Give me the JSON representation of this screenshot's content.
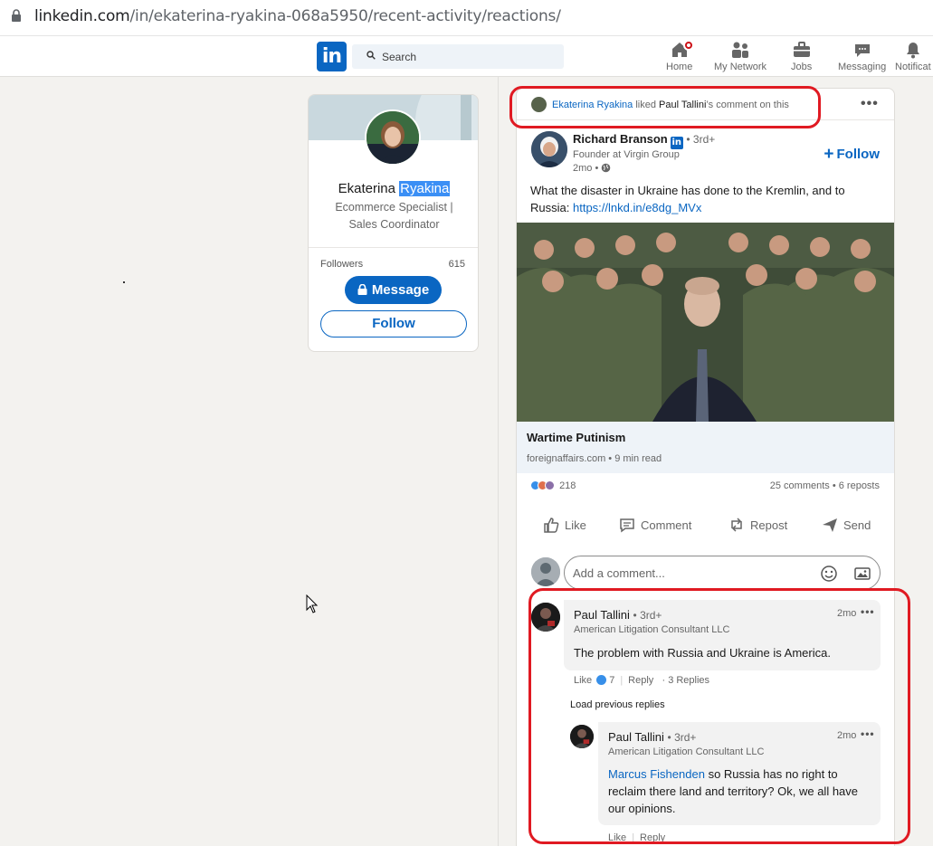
{
  "browser": {
    "url_host": "linkedin.com",
    "url_path": "/in/ekaterina-ryakina-068a5950/recent-activity/reactions/"
  },
  "nav": {
    "search_placeholder": "Search",
    "items": [
      {
        "label": "Home",
        "icon": "home-icon"
      },
      {
        "label": "My Network",
        "icon": "network-icon"
      },
      {
        "label": "Jobs",
        "icon": "jobs-icon"
      },
      {
        "label": "Messaging",
        "icon": "messaging-icon"
      },
      {
        "label": "Notificat",
        "icon": "bell-icon"
      }
    ]
  },
  "profile": {
    "first_name": "Ekaterina",
    "last_name": "Ryakina",
    "headline": "Ecommerce Specialist | Sales Coordinator",
    "followers_label": "Followers",
    "followers_count": "615",
    "message_label": "Message",
    "follow_label": "Follow"
  },
  "activity": {
    "actor": "Ekaterina Ryakina",
    "verb": "liked",
    "target": "Paul Tallini",
    "suffix": "’s comment on this"
  },
  "post": {
    "author": "Richard Branson",
    "degree": "• 3rd+",
    "subtitle": "Founder at Virgin Group",
    "time": "2mo •",
    "follow_label": "Follow",
    "text": "What the disaster in Ukraine has done to the Kremlin, and to Russia:",
    "link": "https://lnkd.in/e8dg_MVx",
    "article_title": "Wartime Putinism",
    "article_source": "foreignaffairs.com • 9 min read",
    "reactions_count": "218",
    "comments_reposts": "25 comments • 6 reposts",
    "actions": {
      "like": "Like",
      "comment": "Comment",
      "repost": "Repost",
      "send": "Send"
    },
    "comment_placeholder": "Add a comment..."
  },
  "comments": [
    {
      "name": "Paul Tallini",
      "degree": "• 3rd+",
      "subtitle": "American Litigation Consultant LLC",
      "time": "2mo",
      "text": "The problem with Russia and Ukraine is America.",
      "like": "Like",
      "likes": "7",
      "reply": "Reply",
      "replies": "· 3 Replies"
    }
  ],
  "load_previous": "Load previous replies",
  "reply": {
    "name": "Paul Tallini",
    "degree": "• 3rd+",
    "subtitle": "American Litigation Consultant LLC",
    "time": "2mo",
    "mention": "Marcus Fishenden",
    "text": "so Russia has no right to reclaim there land and territory? Ok, we all have our opinions.",
    "like": "Like",
    "reply": "Reply"
  },
  "colors": {
    "brand": "#0a66c2",
    "annotation": "#e01a22"
  }
}
